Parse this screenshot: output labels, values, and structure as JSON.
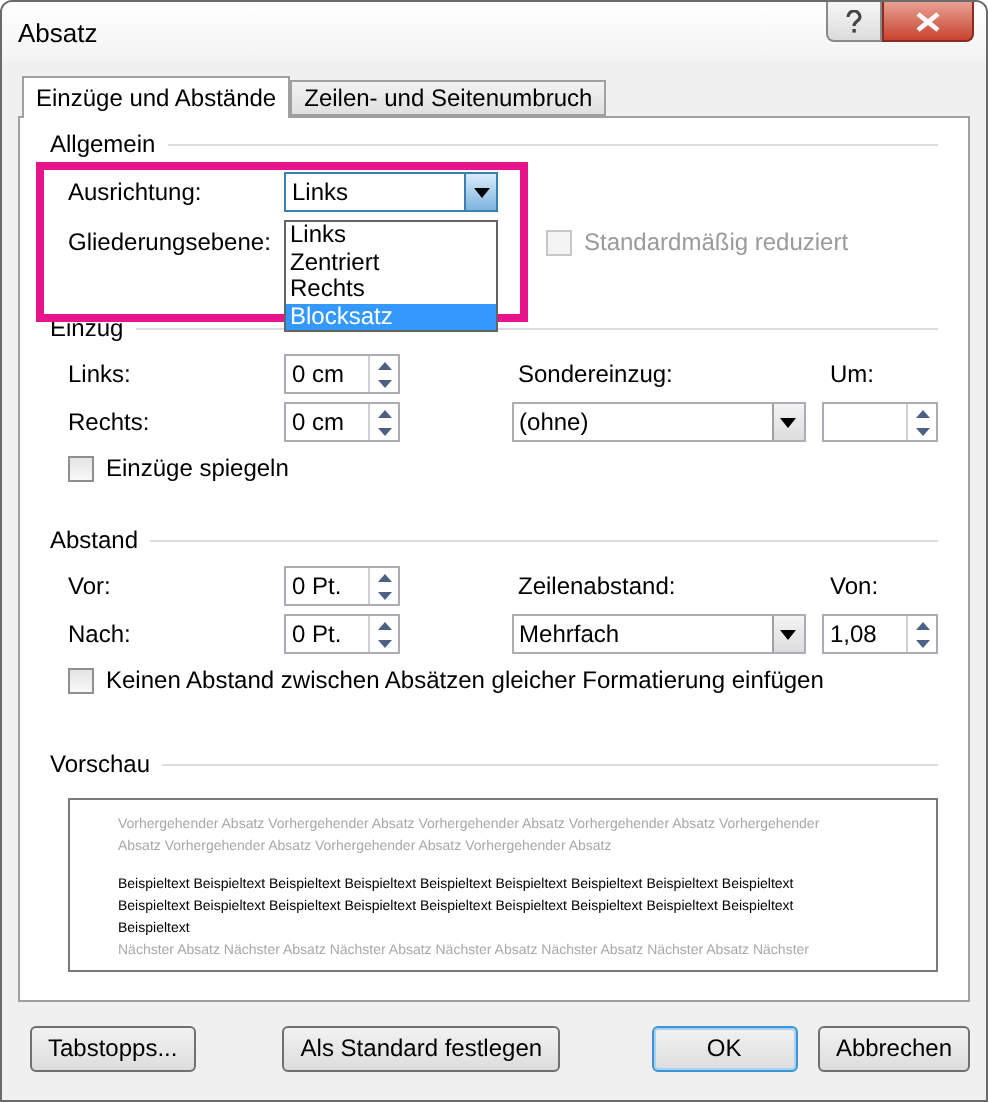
{
  "window": {
    "title": "Absatz"
  },
  "tabs": [
    {
      "label": "Einzüge und Abstände",
      "selected": true
    },
    {
      "label": "Zeilen- und Seitenumbruch",
      "selected": false
    }
  ],
  "general": {
    "heading": "Allgemein",
    "alignment": {
      "label": "Ausrichtung:",
      "value": "Links",
      "expanded": true,
      "options": [
        {
          "label": "Links",
          "highlighted": false
        },
        {
          "label": "Zentriert",
          "highlighted": false
        },
        {
          "label": "Rechts",
          "highlighted": false
        },
        {
          "label": "Blocksatz",
          "highlighted": true
        }
      ]
    },
    "outline_level": {
      "label": "Gliederungsebene:"
    },
    "collapsed": {
      "label": "Standardmäßig reduziert",
      "checked": false,
      "disabled": true
    }
  },
  "indent": {
    "heading": "Einzug",
    "left": {
      "label": "Links:",
      "value": "0 cm"
    },
    "right": {
      "label": "Rechts:",
      "value": "0 cm"
    },
    "special": {
      "label": "Sondereinzug:",
      "value": "(ohne)"
    },
    "by": {
      "label": "Um:"
    },
    "mirror": {
      "label": "Einzüge spiegeln",
      "checked": false
    }
  },
  "spacing": {
    "heading": "Abstand",
    "before": {
      "label": "Vor:",
      "value": "0 Pt."
    },
    "after": {
      "label": "Nach:",
      "value": "0 Pt."
    },
    "line_spacing": {
      "label": "Zeilenabstand:",
      "value": "Mehrfach"
    },
    "at": {
      "label": "Von:",
      "value": "1,08"
    },
    "no_space": {
      "label": "Keinen Abstand zwischen Absätzen gleicher Formatierung einfügen",
      "checked": false
    }
  },
  "preview": {
    "heading": "Vorschau",
    "previous": "Vorhergehender Absatz Vorhergehender Absatz Vorhergehender Absatz Vorhergehender Absatz Vorhergehender Absatz Vorhergehender Absatz Vorhergehender Absatz Vorhergehender Absatz",
    "sample": "Beispieltext Beispieltext Beispieltext Beispieltext Beispieltext Beispieltext Beispieltext Beispieltext Beispieltext Beispieltext Beispieltext Beispieltext Beispieltext Beispieltext Beispieltext Beispieltext Beispieltext Beispieltext Beispieltext",
    "next": "Nächster Absatz Nächster Absatz Nächster Absatz Nächster Absatz Nächster Absatz Nächster Absatz Nächster"
  },
  "buttons": [
    {
      "label": "Tabstopps...",
      "default": false
    },
    {
      "label": "Als Standard festlegen",
      "default": false
    },
    {
      "label": "OK",
      "default": true
    },
    {
      "label": "Abbrechen",
      "default": false
    }
  ]
}
